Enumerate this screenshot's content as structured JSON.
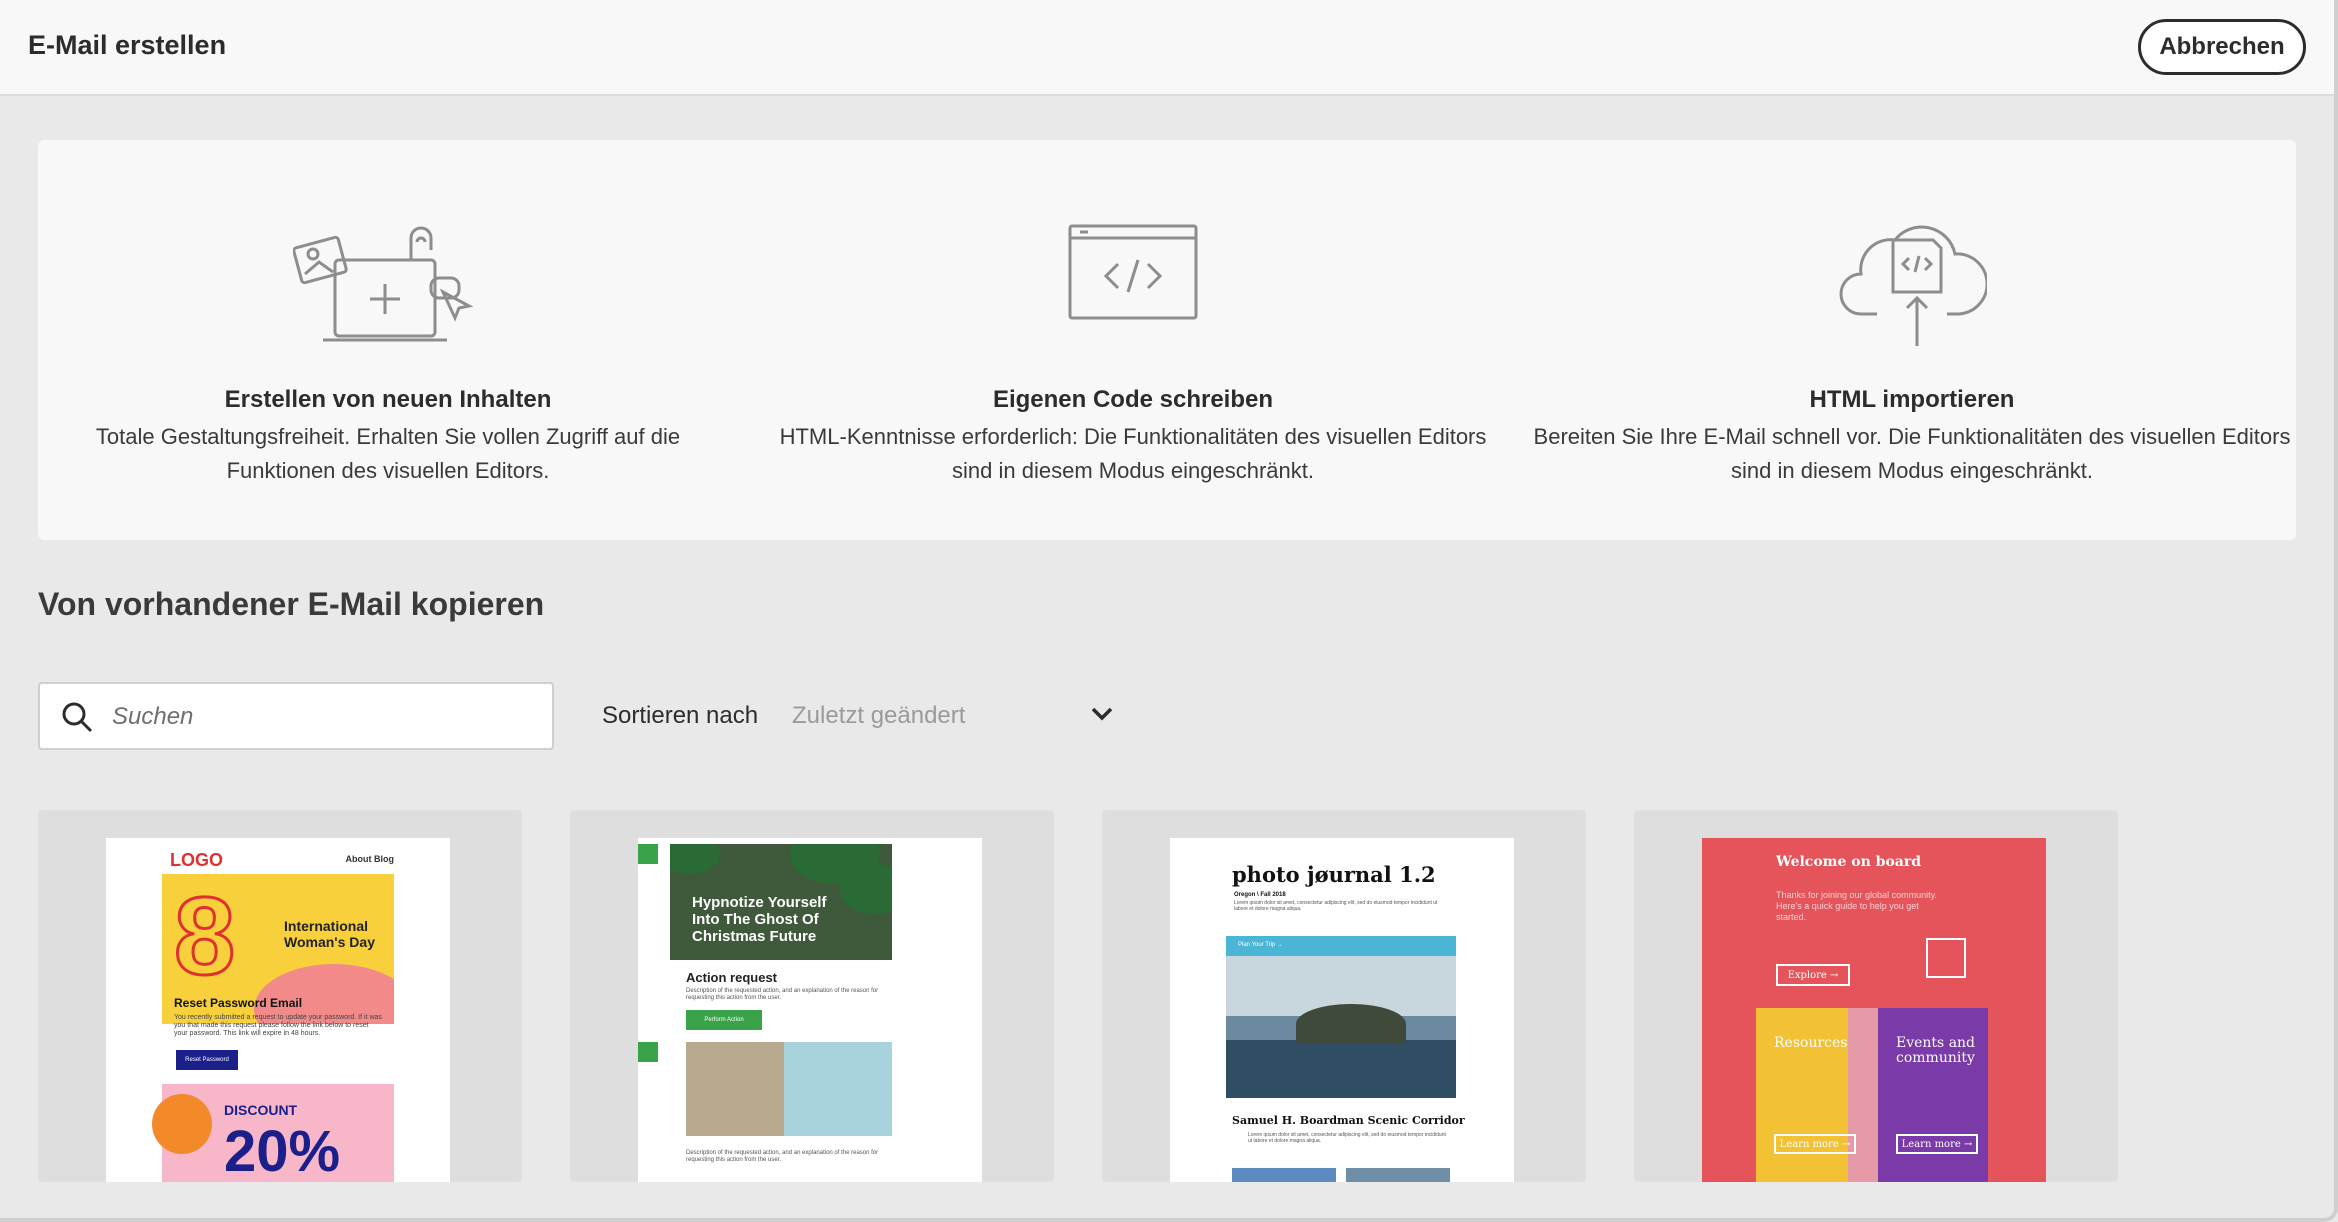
{
  "header": {
    "title": "E-Mail erstellen",
    "cancel_label": "Abbrechen"
  },
  "options": [
    {
      "icon": "create-content-illustration",
      "title": "Erstellen von neuen Inhalten",
      "description_line1": "Totale Gestaltungsfreiheit. Erhalten Sie vollen Zugriff auf die",
      "description_line2": "Funktionen des visuellen Editors."
    },
    {
      "icon": "code-window-illustration",
      "title": "Eigenen Code schreiben",
      "description_line1": "HTML-Kenntnisse erforderlich: Die Funktionalitäten des visuellen Editors",
      "description_line2": "sind in diesem Modus eingeschränkt."
    },
    {
      "icon": "cloud-upload-illustration",
      "title": "HTML importieren",
      "description_line1": "Bereiten Sie Ihre E-Mail schnell vor. Die Funktionalitäten des visuellen Editors",
      "description_line2": "sind in diesem Modus eingeschränkt."
    }
  ],
  "copy_section": {
    "title": "Von vorhandener E-Mail kopieren",
    "search_placeholder": "Suchen",
    "sort_label": "Sortieren nach",
    "sort_value": "Zuletzt geändert"
  },
  "templates": [
    {
      "logo": "LOGO",
      "nav": "About   Blog",
      "hero_number": "8",
      "hero_text": "International Woman's Day",
      "heading": "Reset Password Email",
      "body": "You recently submitted a request to update your password. If it was you that made this request please follow the link below to reset your password. This link will expire in 48 hours.",
      "button": "Reset Password",
      "discount_label": "DISCOUNT",
      "discount_value": "20%"
    },
    {
      "hero_text": "Hypnotize Yourself Into The Ghost Of Christmas Future",
      "heading": "Action request",
      "body": "Description of the requested action, and an explanation of the reason for requesting this action from the user.",
      "button": "Perform Action",
      "body2": "Description of the requested action, and an explanation of the reason for requesting this action from the user."
    },
    {
      "title": "photo jøurnal 1.2",
      "subtitle": "Oregon \\ Fall 2018",
      "bar_text": "Plan Your Trip →",
      "heading": "Samuel H. Boardman Scenic Corridor",
      "body": "Lorem ipsum dolor sit amet, consectetur adipiscing elit, sed do eiusmod tempor incididunt ut labore et dolore magna aliqua."
    },
    {
      "welcome": "Welcome on board",
      "intro": "Thanks for joining our global community. Here's a quick guide to help you get started.",
      "explore": "Explore →",
      "left_label": "Resources",
      "right_label": "Events and community",
      "learn_more": "Learn more →"
    }
  ],
  "colors": {
    "accent_green": "#3aa34a",
    "accent_red": "#e4545a",
    "accent_purple": "#7a3aa8"
  }
}
